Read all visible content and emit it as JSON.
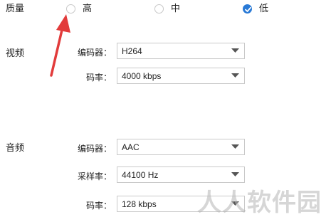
{
  "quality": {
    "label": "质量",
    "options": [
      {
        "label": "高",
        "checked": false
      },
      {
        "label": "中",
        "checked": false
      },
      {
        "label": "低",
        "checked": true
      }
    ]
  },
  "video": {
    "section_label": "视频",
    "encoder": {
      "label": "编码器：",
      "value": "H264"
    },
    "bitrate": {
      "label": "码率：",
      "value": "4000 kbps"
    }
  },
  "audio": {
    "section_label": "音频",
    "encoder": {
      "label": "编码器：",
      "value": "AAC"
    },
    "samplerate": {
      "label": "采样率：",
      "value": "44100 Hz"
    },
    "bitrate": {
      "label": "码率：",
      "value": "128 kbps"
    }
  },
  "watermark": "人人软件园",
  "colors": {
    "accent": "#2a7ad6",
    "annotation_arrow": "#e23b3b"
  }
}
